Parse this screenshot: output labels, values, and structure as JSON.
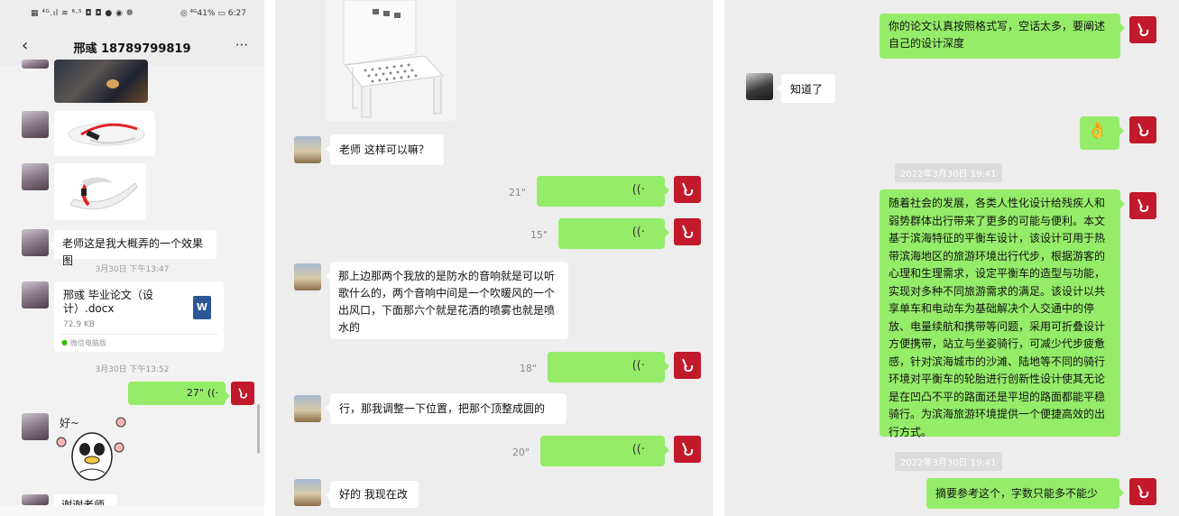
{
  "panel1": {
    "status_left": "▦ ⁴ᴳ.ıl ≋ ⁶·⁵ ◘ ◘ ● ◉ ❁",
    "status_right": "◎ ⁴ᴳ41% ▭ 6:27",
    "title": "邢彧 18789799819",
    "back_icon": "‹",
    "more_icon": "···",
    "msg_effect": "老师这是我大概弄的一个效果图",
    "ts1": "3月30日 下午13:47",
    "file_name": "邢彧 毕业论文（设计）.docx",
    "file_size": "72.9 KB",
    "file_source": "微信电脑版",
    "file_icon_letter": "W",
    "ts2": "3月30日 下午13:52",
    "voice_duration": "27\"",
    "sticker_text": "好~",
    "msg_last": "谢谢老师"
  },
  "panel2": {
    "msg1": "老师 这样可以嘛？",
    "voice1": "21\"",
    "voice2": "15\"",
    "msg2": "那上边那两个我放的是防水的音响就是可以听歌什么的，两个音响中间是一个吹暖风的一个出风口，下面那六个就是花洒的喷雾也就是喷水的",
    "voice3": "18\"",
    "msg3": "行，那我调整一下位置，把那个顶整成圆的",
    "voice4": "20\"",
    "msg4": "好的 我现在改"
  },
  "panel3": {
    "msg_top": "你的论文认真按照格式写，空话太多，要阐述自己的设计深度",
    "reply": "知道了",
    "emoji": "👌",
    "ts1": "2022年3月30日 19:41",
    "abstract": "随着社会的发展，各类人性化设计给残疾人和弱势群体出行带来了更多的可能与便利。本文基于滨海特征的平衡车设计，该设计可用于热带滨海地区的旅游环境出行代步，根据游客的心理和生理需求，设定平衡车的造型与功能，实现对多种不同旅游需求的满足。该设计以共享单车和电动车为基础解决个人交通中的停放、电量续航和携带等问题，采用可折叠设计方便携带，站立与坐姿骑行，可减少代步疲惫感，针对滨海城市的沙滩、陆地等不同的骑行环境对平衡车的轮胎进行创新性设计使其无论是在凹凸不平的路面还是平坦的路面都能平稳骑行。为滨海旅游环境提供一个便捷高效的出行方式。",
    "ts2": "2022年3月30日 19:41",
    "msg_bottom": "摘要参考这个，字数只能多不能少"
  },
  "icons": {
    "voice_wave": "((·",
    "me_avatar": "hook-logo-icon"
  },
  "colors": {
    "my_bubble": "#95ec69",
    "my_avatar": "#c2192b",
    "bg": "#ededed"
  }
}
